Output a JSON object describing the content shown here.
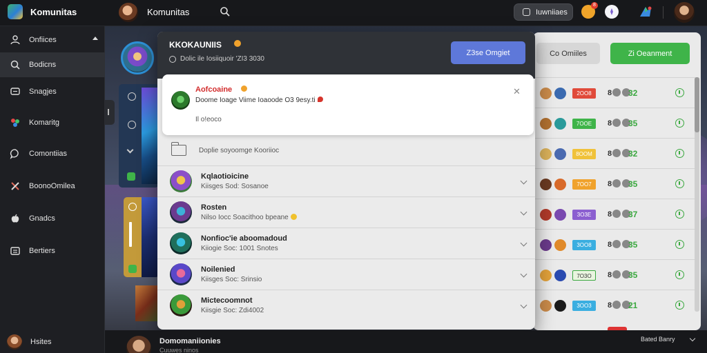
{
  "app": {
    "title": "Komunitas"
  },
  "topbar": {
    "title": "Komunitas",
    "pill_label": "Iuwniiaes",
    "bell_count": "8"
  },
  "sidebar": {
    "items": [
      {
        "label": "Onfiices",
        "icon": "users-icon",
        "active": false
      },
      {
        "label": "Bodicns",
        "icon": "search-icon",
        "active": true
      },
      {
        "label": "Snagjes",
        "icon": "message-icon",
        "active": false
      },
      {
        "label": "Komaritg",
        "icon": "palette-icon",
        "active": false
      },
      {
        "label": "Comontiias",
        "icon": "chat-bubble-icon",
        "active": false
      },
      {
        "label": "BoonoOmilea",
        "icon": "tools-icon",
        "active": false
      },
      {
        "label": "Gnadcs",
        "icon": "apple-icon",
        "active": false
      },
      {
        "label": "Bertiers",
        "icon": "list-icon",
        "active": false
      }
    ],
    "bottom_label": "Hsites"
  },
  "modal": {
    "title": "KKOKAUNIIS",
    "subtitle": "Dolic ile Iosiiquoir  'ZI3 3030",
    "primary_button": "Z3se Omgiet",
    "notice": {
      "title": "Aofcoaine",
      "body": "Doome Ioage Viime Ioaoode O3 9esy.ti",
      "meta": "Il o!eoco"
    },
    "section_label": "Doplie soyoomge Kooriioc",
    "rows": [
      {
        "name": "Kqlaotioicine",
        "sub": "Kiisges Sod: Sosanoe",
        "emoji": false,
        "avatar_colors": [
          "#f1c54a",
          "#8b4fc9",
          "#3b7a3b"
        ]
      },
      {
        "name": "Rosten",
        "sub": "Nilso Iocc Soacithoo bpeane",
        "emoji": true,
        "avatar_colors": [
          "#3db0d8",
          "#6b3a8f",
          "#1c2a3a"
        ]
      },
      {
        "name": "Nonfioc'ie aboomadoud",
        "sub": "Kiiogie Soc: 1001 Snotes",
        "emoji": false,
        "avatar_colors": [
          "#37c1e0",
          "#1f6f5b",
          "#0d2a2a"
        ]
      },
      {
        "name": "Noilenied",
        "sub": "Kiisges Soc: Srinsio",
        "emoji": false,
        "avatar_colors": [
          "#e86a9a",
          "#5a48c9",
          "#1b2a4a"
        ]
      },
      {
        "name": "Mictecoomnot",
        "sub": "Kiisgie Soc: Zdi4002",
        "emoji": false,
        "avatar_colors": [
          "#e0a03a",
          "#3a9a3a",
          "#2a1a12"
        ]
      }
    ]
  },
  "right_panel": {
    "button_grey": "Co Omiiles",
    "button_green": "Zi Oeanment",
    "rows": [
      {
        "badge": "2OO8",
        "badge_color": "#e04a3a",
        "stat": "8",
        "score": "32",
        "ava1": "#c98a4a",
        "ava2": "#3a6ab0"
      },
      {
        "badge": "7OOE",
        "badge_color": "#3fb449",
        "stat": "8",
        "score": "35",
        "ava1": "#b07030",
        "ava2": "#2a9a9a"
      },
      {
        "badge": "8OOM",
        "badge_color": "#f0c23a",
        "stat": "8",
        "score": "32",
        "ava1": "#d8b05a",
        "ava2": "#4a6ab0"
      },
      {
        "badge": "7OO7",
        "badge_color": "#f0a22c",
        "stat": "8",
        "score": "35",
        "ava1": "#6a3a22",
        "ava2": "#d86a2a"
      },
      {
        "badge": "3O3E",
        "badge_color": "#8b5fd0",
        "stat": "8",
        "score": "37",
        "ava1": "#b03a2a",
        "ava2": "#7a4ab0"
      },
      {
        "badge": "3OO8",
        "badge_color": "#3aaee0",
        "stat": "8",
        "score": "35",
        "ava1": "#6a3a8a",
        "ava2": "#e08a2a"
      },
      {
        "badge": "7O3O",
        "badge_color": "#eaf5e0",
        "stat": "8",
        "score": "35",
        "ava1": "#e0a03a",
        "ava2": "#2a4ab0"
      },
      {
        "badge": "3OO3",
        "badge_color": "#3aaee0",
        "stat": "8",
        "score": "21",
        "ava1": "#c98a4a",
        "ava2": "#1a1a1a"
      }
    ]
  },
  "bottombar": {
    "title": "Domomaniionies",
    "sub": "Cuuwes ninos",
    "right_label": "Bated Banry"
  },
  "colors": {
    "accent_blue": "#5e78d9",
    "accent_green": "#3fb449",
    "notice_red": "#d22c2c"
  }
}
